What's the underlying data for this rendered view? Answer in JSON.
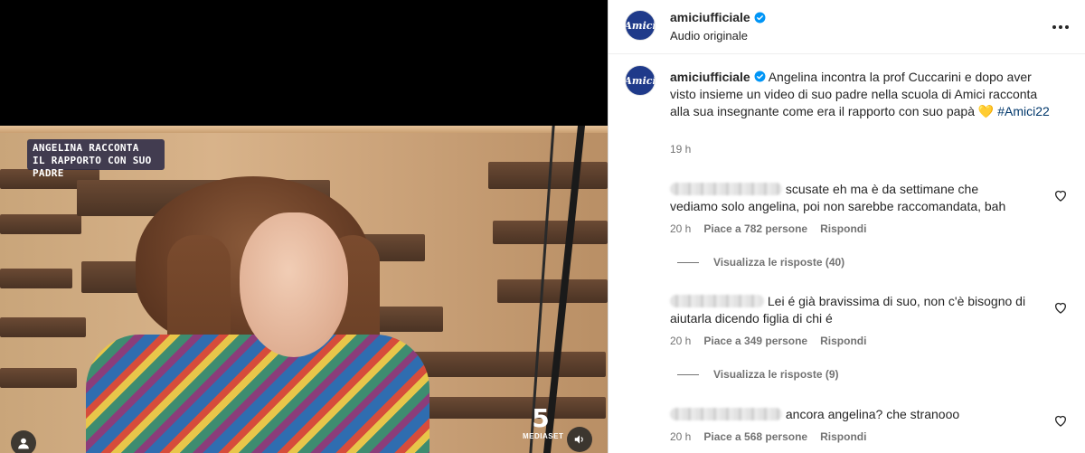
{
  "video": {
    "overlay_caption": [
      "ANGELINA RACCONTA",
      "IL RAPPORTO CON SUO PADRE"
    ],
    "channel_logo": {
      "mark": "5",
      "name": "MEDIASET"
    },
    "mute_icon": "speaker-icon",
    "user_icon": "user-icon"
  },
  "post": {
    "username": "amiciufficiale",
    "subtitle": "Audio originale",
    "avatar_text": "Amici",
    "caption": {
      "username": "amiciufficiale",
      "text": "Angelina incontra la prof Cuccarini e dopo aver visto insieme un video di suo padre nella scuola di Amici racconta alla sua insegnante come era il rapporto con suo papà",
      "emoji": "💛",
      "hashtag": "#Amici22",
      "time": "19 h"
    }
  },
  "comments": [
    {
      "text": "scusate eh ma è da settimane che vediamo solo angelina, poi non sarebbe raccomandata, bah",
      "time": "20 h",
      "likes": "Piace a 782 persone",
      "reply": "Rispondi",
      "view_replies": "Visualizza le risposte (40)"
    },
    {
      "text": "Lei é già bravissima di suo, non c'è bisogno di aiutarla dicendo figlia di chi é",
      "time": "20 h",
      "likes": "Piace a 349 persone",
      "reply": "Rispondi",
      "view_replies": "Visualizza le risposte (9)"
    },
    {
      "text": "ancora angelina? che stranooo",
      "time": "20 h",
      "likes": "Piace a 568 persone",
      "reply": "Rispondi"
    }
  ],
  "colors": {
    "verified": "#0095f6",
    "hashtag": "#00376b",
    "secondary_text": "#737373",
    "avatar_bg": "#1f3a8a"
  }
}
